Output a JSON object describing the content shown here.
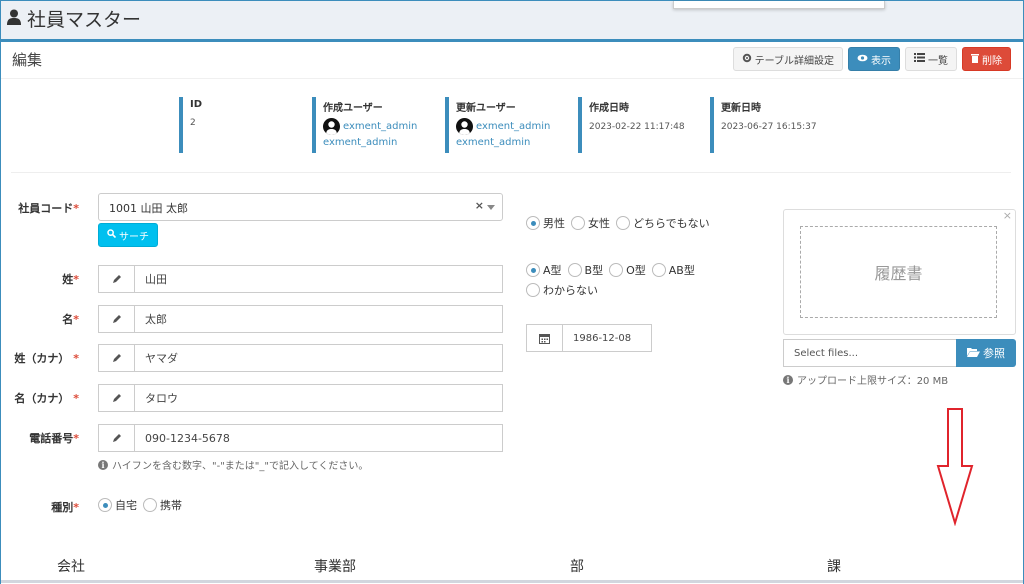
{
  "header": {
    "title": "社員マスター"
  },
  "box": {
    "title": "編集",
    "tools": {
      "table_settings": "テーブル詳細設定",
      "view": "表示",
      "list": "一覧",
      "delete": "削除"
    }
  },
  "meta": {
    "id": {
      "label": "ID",
      "value": "2"
    },
    "created_user": {
      "label": "作成ユーザー",
      "name": "exment_admin",
      "sub": "exment_admin"
    },
    "updated_user": {
      "label": "更新ユーザー",
      "name": "exment_admin",
      "sub": "exment_admin"
    },
    "created_at": {
      "label": "作成日時",
      "value": "2023-02-22 11:17:48"
    },
    "updated_at": {
      "label": "更新日時",
      "value": "2023-06-27 16:15:37"
    }
  },
  "form": {
    "employee_code": {
      "label": "社員コード",
      "value": "1001 山田 太郎",
      "search_label": "サーチ"
    },
    "last_name": {
      "label": "姓",
      "value": "山田"
    },
    "first_name": {
      "label": "名",
      "value": "太郎"
    },
    "last_name_kana": {
      "label": "姓（カナ）",
      "value": "ヤマダ"
    },
    "first_name_kana": {
      "label": "名（カナ）",
      "value": "タロウ"
    },
    "phone": {
      "label": "電話番号",
      "value": "090-1234-5678",
      "help": "ハイフンを含む数字、\"-\"または\"_\"で記入してください。"
    },
    "type": {
      "label": "種別",
      "options": [
        "自宅",
        "携帯"
      ],
      "selected": 0
    },
    "gender": {
      "options": [
        "男性",
        "女性",
        "どちらでもない"
      ],
      "selected": 0
    },
    "blood": {
      "options": [
        "A型",
        "B型",
        "O型",
        "AB型",
        "わからない"
      ],
      "selected": 0
    },
    "birthday": {
      "value": "1986-12-08"
    },
    "resume": {
      "preview_label": "履歴書",
      "placeholder": "Select files...",
      "browse_label": "参照",
      "help": "アップロード上限サイズ：20 MB"
    }
  },
  "columns": [
    "会社",
    "事業部",
    "部",
    "課"
  ],
  "colors": {
    "accent": "#3c8dbc",
    "danger": "#dd4b39",
    "info": "#00c0ef",
    "annotation_arrow": "#e0242c"
  }
}
